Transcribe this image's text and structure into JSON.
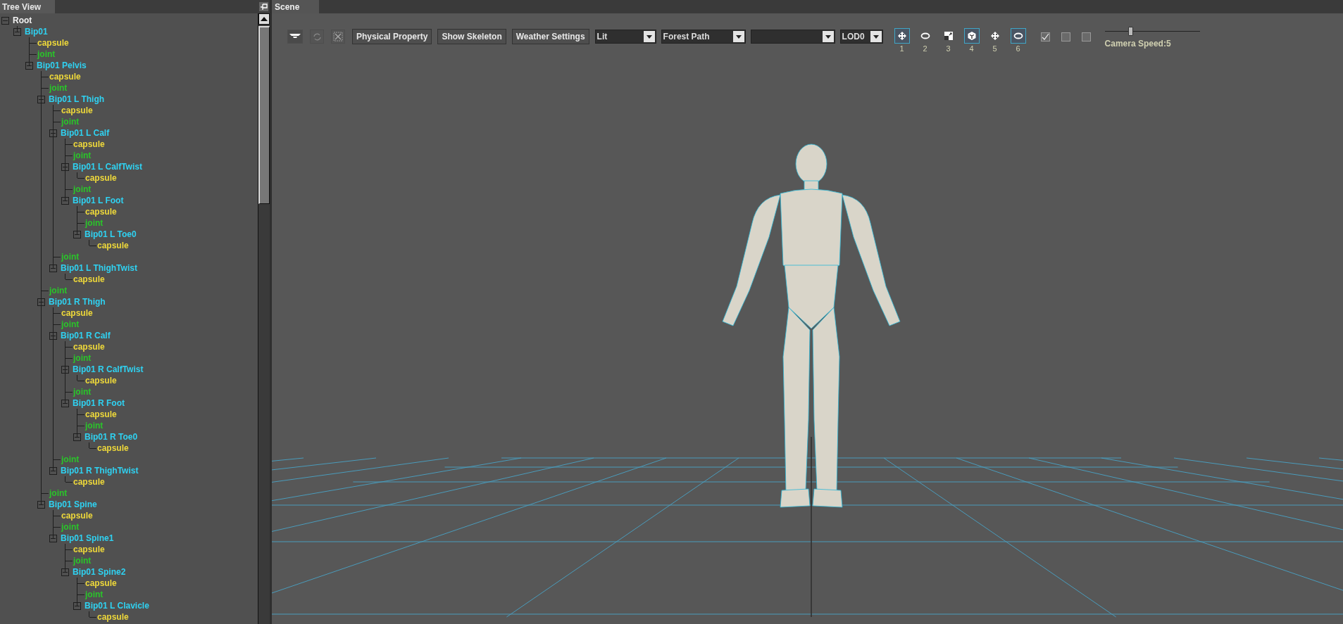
{
  "tree_view": {
    "title": "Tree View",
    "nodes": [
      {
        "label": "Root",
        "kind": "root",
        "expanded": true,
        "children": [
          {
            "label": "Bip01",
            "kind": "bone",
            "expanded": true,
            "children": [
              {
                "label": "capsule",
                "kind": "capsule"
              },
              {
                "label": "joint",
                "kind": "joint"
              },
              {
                "label": "Bip01 Pelvis",
                "kind": "bone",
                "expanded": true,
                "children": [
                  {
                    "label": "capsule",
                    "kind": "capsule"
                  },
                  {
                    "label": "joint",
                    "kind": "joint"
                  },
                  {
                    "label": "Bip01 L Thigh",
                    "kind": "bone",
                    "expanded": true,
                    "children": [
                      {
                        "label": "capsule",
                        "kind": "capsule"
                      },
                      {
                        "label": "joint",
                        "kind": "joint"
                      },
                      {
                        "label": "Bip01 L Calf",
                        "kind": "bone",
                        "expanded": true,
                        "children": [
                          {
                            "label": "capsule",
                            "kind": "capsule"
                          },
                          {
                            "label": "joint",
                            "kind": "joint"
                          },
                          {
                            "label": "Bip01 L CalfTwist",
                            "kind": "bone",
                            "expanded": true,
                            "children": [
                              {
                                "label": "capsule",
                                "kind": "capsule"
                              }
                            ]
                          },
                          {
                            "label": "joint",
                            "kind": "joint"
                          },
                          {
                            "label": "Bip01 L Foot",
                            "kind": "bone",
                            "expanded": true,
                            "children": [
                              {
                                "label": "capsule",
                                "kind": "capsule"
                              },
                              {
                                "label": "joint",
                                "kind": "joint"
                              },
                              {
                                "label": "Bip01 L Toe0",
                                "kind": "bone",
                                "expanded": true,
                                "children": [
                                  {
                                    "label": "capsule",
                                    "kind": "capsule"
                                  }
                                ]
                              }
                            ]
                          }
                        ]
                      },
                      {
                        "label": "joint",
                        "kind": "joint"
                      },
                      {
                        "label": "Bip01 L ThighTwist",
                        "kind": "bone",
                        "expanded": true,
                        "children": [
                          {
                            "label": "capsule",
                            "kind": "capsule"
                          }
                        ]
                      }
                    ]
                  },
                  {
                    "label": "joint",
                    "kind": "joint"
                  },
                  {
                    "label": "Bip01 R Thigh",
                    "kind": "bone",
                    "expanded": true,
                    "children": [
                      {
                        "label": "capsule",
                        "kind": "capsule"
                      },
                      {
                        "label": "joint",
                        "kind": "joint"
                      },
                      {
                        "label": "Bip01 R Calf",
                        "kind": "bone",
                        "expanded": true,
                        "children": [
                          {
                            "label": "capsule",
                            "kind": "capsule"
                          },
                          {
                            "label": "joint",
                            "kind": "joint"
                          },
                          {
                            "label": "Bip01 R CalfTwist",
                            "kind": "bone",
                            "expanded": true,
                            "children": [
                              {
                                "label": "capsule",
                                "kind": "capsule"
                              }
                            ]
                          },
                          {
                            "label": "joint",
                            "kind": "joint"
                          },
                          {
                            "label": "Bip01 R Foot",
                            "kind": "bone",
                            "expanded": true,
                            "children": [
                              {
                                "label": "capsule",
                                "kind": "capsule"
                              },
                              {
                                "label": "joint",
                                "kind": "joint"
                              },
                              {
                                "label": "Bip01 R Toe0",
                                "kind": "bone",
                                "expanded": true,
                                "children": [
                                  {
                                    "label": "capsule",
                                    "kind": "capsule"
                                  }
                                ]
                              }
                            ]
                          }
                        ]
                      },
                      {
                        "label": "joint",
                        "kind": "joint"
                      },
                      {
                        "label": "Bip01 R ThighTwist",
                        "kind": "bone",
                        "expanded": true,
                        "children": [
                          {
                            "label": "capsule",
                            "kind": "capsule"
                          }
                        ]
                      }
                    ]
                  },
                  {
                    "label": "joint",
                    "kind": "joint"
                  },
                  {
                    "label": "Bip01 Spine",
                    "kind": "bone",
                    "expanded": true,
                    "children": [
                      {
                        "label": "capsule",
                        "kind": "capsule"
                      },
                      {
                        "label": "joint",
                        "kind": "joint"
                      },
                      {
                        "label": "Bip01 Spine1",
                        "kind": "bone",
                        "expanded": true,
                        "children": [
                          {
                            "label": "capsule",
                            "kind": "capsule"
                          },
                          {
                            "label": "joint",
                            "kind": "joint"
                          },
                          {
                            "label": "Bip01 Spine2",
                            "kind": "bone",
                            "expanded": true,
                            "children": [
                              {
                                "label": "capsule",
                                "kind": "capsule"
                              },
                              {
                                "label": "joint",
                                "kind": "joint"
                              },
                              {
                                "label": "Bip01 L Clavicle",
                                "kind": "bone",
                                "expanded": true,
                                "children": [
                                  {
                                    "label": "capsule",
                                    "kind": "capsule"
                                  }
                                ]
                              }
                            ]
                          }
                        ]
                      }
                    ]
                  }
                ]
              }
            ]
          }
        ]
      }
    ]
  },
  "scene": {
    "title": "Scene",
    "text_buttons": [
      "Physical Property",
      "Show Skeleton",
      "Weather Settings"
    ],
    "dropdowns": [
      {
        "kind": "select",
        "value": "Lit"
      },
      {
        "kind": "select",
        "value": "Forest Path"
      },
      {
        "kind": "blank"
      },
      {
        "kind": "select",
        "value": "LOD0"
      }
    ],
    "gizmo_buttons": [
      {
        "label": "1",
        "selected": true
      },
      {
        "label": "2",
        "selected": false
      },
      {
        "label": "3",
        "selected": false
      },
      {
        "label": "4",
        "selected": true
      },
      {
        "label": "5",
        "selected": false
      },
      {
        "label": "6",
        "selected": true
      }
    ],
    "checkboxes": [
      {
        "checked": true
      },
      {
        "checked": false
      },
      {
        "checked": false
      }
    ],
    "camera_speed": {
      "level": 0.27,
      "label": "Camera Speed:5"
    }
  }
}
